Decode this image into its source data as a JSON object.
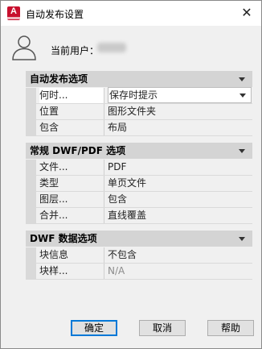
{
  "window": {
    "title": "自动发布设置",
    "app_icon_letter": "A",
    "close_glyph": "✕"
  },
  "user": {
    "label": "当前用户："
  },
  "sections": [
    {
      "title": "自动发布选项",
      "rows": [
        {
          "name": "何时...",
          "value": "保存时提示",
          "selected": true,
          "dropdown": true,
          "disabled": false
        },
        {
          "name": "位置",
          "value": "图形文件夹",
          "selected": false,
          "dropdown": false,
          "disabled": false
        },
        {
          "name": "包含",
          "value": "布局",
          "selected": false,
          "dropdown": false,
          "disabled": false
        }
      ]
    },
    {
      "title": "常规 DWF/PDF 选项",
      "rows": [
        {
          "name": "文件...",
          "value": "PDF",
          "selected": false,
          "dropdown": false,
          "disabled": false
        },
        {
          "name": "类型",
          "value": "单页文件",
          "selected": false,
          "dropdown": false,
          "disabled": false
        },
        {
          "name": "图层...",
          "value": "包含",
          "selected": false,
          "dropdown": false,
          "disabled": false
        },
        {
          "name": "合并...",
          "value": "直线覆盖",
          "selected": false,
          "dropdown": false,
          "disabled": false
        }
      ]
    },
    {
      "title": "DWF 数据选项",
      "rows": [
        {
          "name": "块信息",
          "value": "不包含",
          "selected": false,
          "dropdown": false,
          "disabled": false
        },
        {
          "name": "块样...",
          "value": "N/A",
          "selected": false,
          "dropdown": false,
          "disabled": true
        }
      ]
    }
  ],
  "buttons": {
    "ok": "确定",
    "cancel": "取消",
    "help": "帮助"
  },
  "colors": {
    "app_icon": "#c8102e",
    "dialog_bg": "#f0f0f0",
    "section_header_bg": "#d4d4d4",
    "default_button_border": "#0078d7"
  }
}
